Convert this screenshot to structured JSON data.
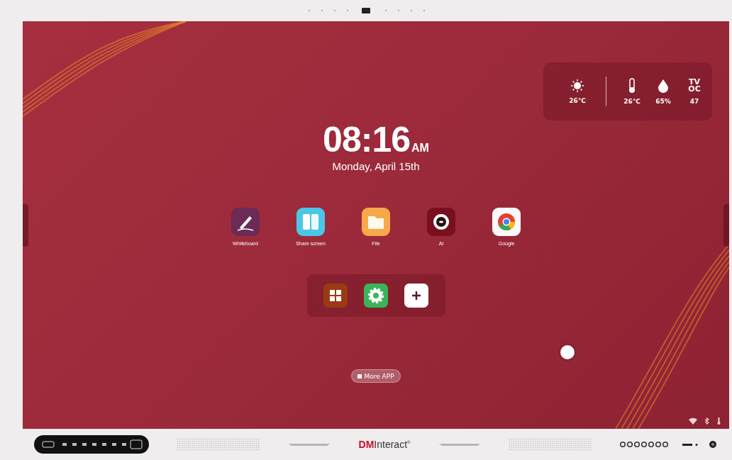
{
  "weather": {
    "outdoor": "26℃",
    "sensors": [
      {
        "kind": "temperature",
        "reading": "26℃"
      },
      {
        "kind": "humidity",
        "reading": "65%"
      },
      {
        "kind": "tvoc",
        "label_lines": [
          "TV",
          "OC"
        ],
        "reading": "47"
      }
    ]
  },
  "clock": {
    "time": "08:16",
    "meridiem": "AM",
    "date": "Monday, April 15th"
  },
  "apps": [
    {
      "kind": "whiteboard",
      "label": "Whiteboard"
    },
    {
      "kind": "share",
      "label": "Share screen"
    },
    {
      "kind": "file",
      "label": "File"
    },
    {
      "kind": "ai",
      "label": "AI"
    },
    {
      "kind": "browser",
      "label": "Google"
    }
  ],
  "dock": [
    {
      "kind": "windows"
    },
    {
      "kind": "settings"
    },
    {
      "kind": "add"
    }
  ],
  "more_button": "More APP",
  "logo": "**DM**Interact$^{®}$"
}
